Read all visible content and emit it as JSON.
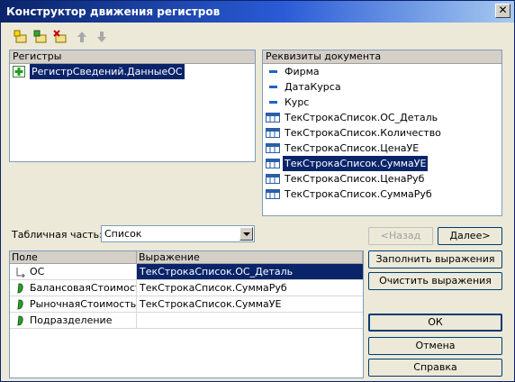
{
  "window": {
    "title": "Конструктор движения регистров",
    "close_glyph": "✕"
  },
  "toolbar": [
    {
      "name": "add-register-icon"
    },
    {
      "name": "add-register-green-icon"
    },
    {
      "name": "delete-register-icon"
    },
    {
      "name": "move-up-icon"
    },
    {
      "name": "move-down-icon"
    }
  ],
  "registers": {
    "header": "Регистры",
    "items": [
      {
        "label": "РегистрСведений.ДанныеОС",
        "selected": true
      }
    ]
  },
  "attributes": {
    "header": "Реквизиты документа",
    "items": [
      {
        "label": "Фирма",
        "icon": "dash"
      },
      {
        "label": "ДатаКурса",
        "icon": "dash"
      },
      {
        "label": "Курс",
        "icon": "dash"
      },
      {
        "label": "ТекСтрокаСписок.ОС_Деталь",
        "icon": "table"
      },
      {
        "label": "ТекСтрокаСписок.Количество",
        "icon": "table"
      },
      {
        "label": "ТекСтрокаСписок.ЦенаУЕ",
        "icon": "table"
      },
      {
        "label": "ТекСтрокаСписок.СуммаУЕ",
        "icon": "table",
        "selected": true
      },
      {
        "label": "ТекСтрокаСписок.ЦенаРуб",
        "icon": "table"
      },
      {
        "label": "ТекСтрокаСписок.СуммаРуб",
        "icon": "table"
      }
    ]
  },
  "tabular": {
    "label": "Табличная часть:",
    "value": "Список"
  },
  "nav": {
    "back": "<Назад",
    "next": "Далее>"
  },
  "grid": {
    "columns": [
      "Поле",
      "Выражение"
    ],
    "rows": [
      {
        "field": "ОС",
        "expr": "ТекСтрокаСписок.ОС_Деталь",
        "icon": "dim",
        "selected": true
      },
      {
        "field": "БалансоваяСтоимость",
        "expr": "ТекСтрокаСписок.СуммаРуб",
        "icon": "res"
      },
      {
        "field": "РыночнаяСтоимость",
        "expr": "ТекСтрокаСписок.СуммаУЕ",
        "icon": "res"
      },
      {
        "field": "Подразделение",
        "expr": "",
        "icon": "res"
      }
    ]
  },
  "actions": {
    "fill": "Заполнить выражения",
    "clear": "Очистить выражения",
    "ok": "ОК",
    "cancel": "Отмена",
    "help": "Справка"
  },
  "colors": {
    "selection": "#0a246a",
    "title_start": "#0a246a",
    "title_end": "#a6caf0"
  }
}
